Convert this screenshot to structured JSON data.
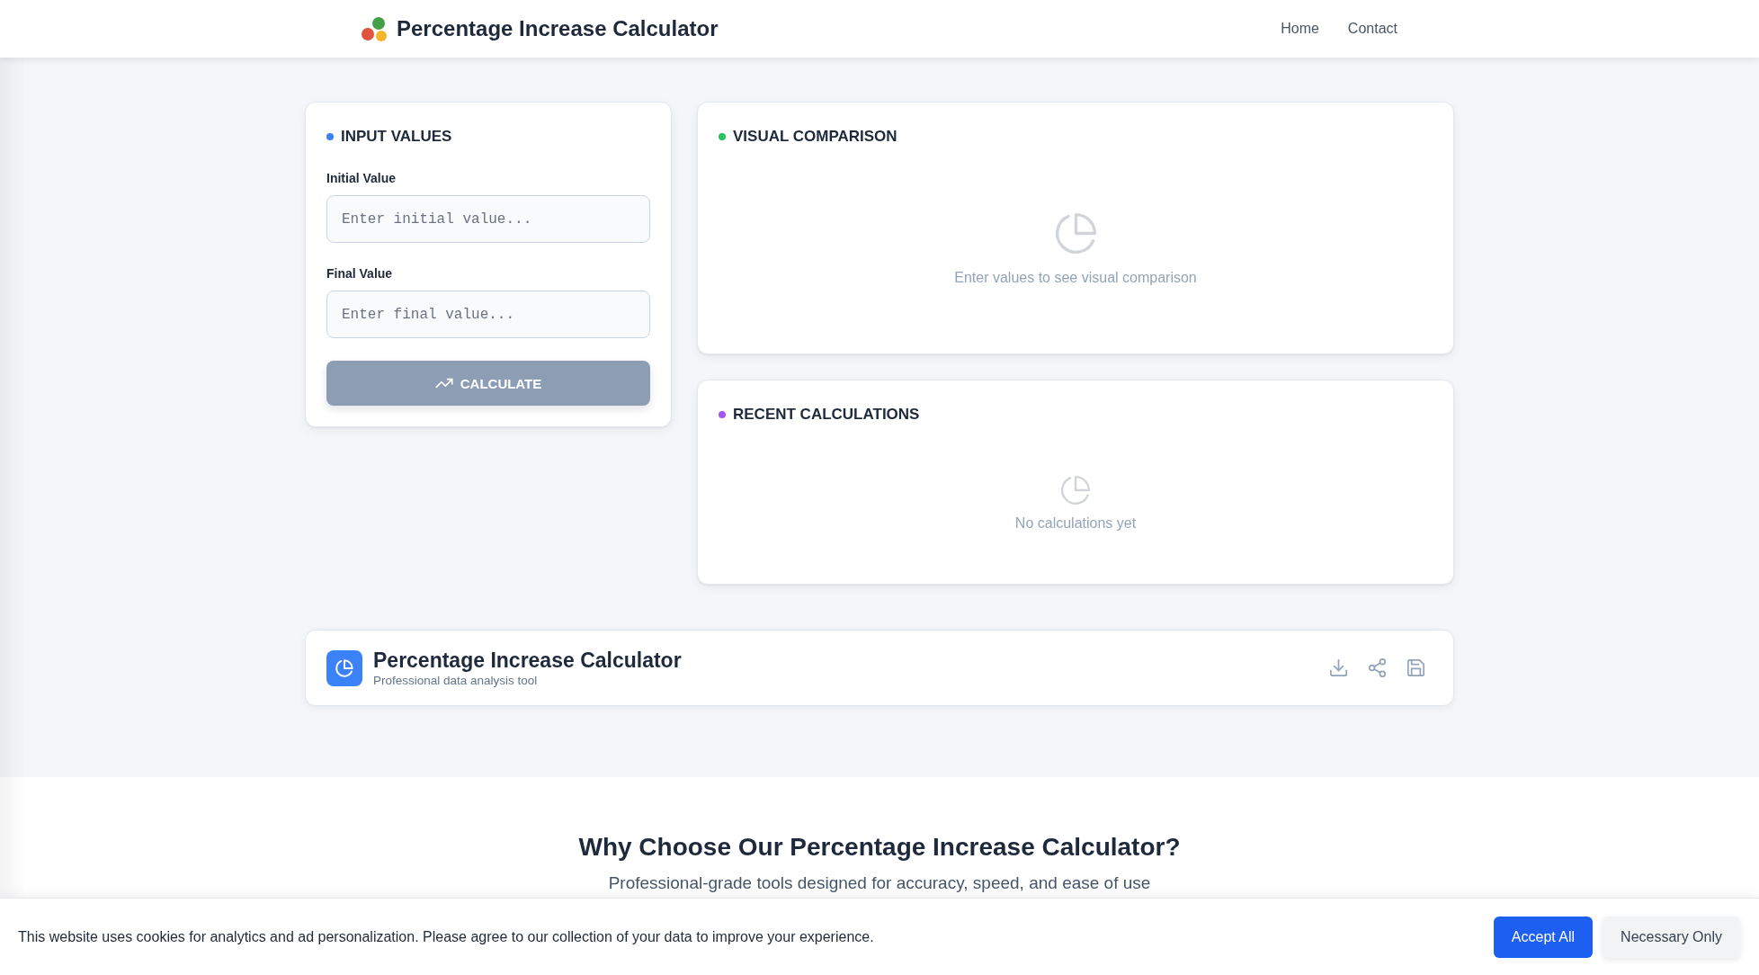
{
  "header": {
    "title": "Percentage Increase Calculator",
    "nav": [
      {
        "label": "Home"
      },
      {
        "label": "Contact"
      }
    ]
  },
  "panels": [
    {
      "kind": "form",
      "title": "INPUT VALUES",
      "color": "#3b82f6",
      "fields": [
        {
          "label": "Initial Value",
          "placeholder": "Enter initial value..."
        },
        {
          "label": "Final Value",
          "placeholder": "Enter final value..."
        }
      ],
      "button": {
        "label": "CALCULATE",
        "disabled": true
      }
    },
    {
      "kind": "empty",
      "title": "VISUAL COMPARISON",
      "color": "#22c55e",
      "message": "Enter values to see visual comparison"
    },
    {
      "kind": "empty",
      "title": "RECENT CALCULATIONS",
      "color": "#a855f7",
      "message": "No calculations yet"
    }
  ],
  "tool_bar": {
    "title": "Percentage Increase Calculator",
    "subtitle": "Professional data analysis tool"
  },
  "features": {
    "heading": "Why Choose Our Percentage Increase Calculator?",
    "subheading": "Professional-grade tools designed for accuracy, speed, and ease of use"
  },
  "cookie_banner": {
    "message": "This website uses cookies for analytics and ad personalization. Please agree to our collection of your data to improve your experience.",
    "buttons": [
      {
        "label": "Accept All",
        "kind": "primary"
      },
      {
        "label": "Necessary Only",
        "kind": "secondary"
      }
    ]
  }
}
